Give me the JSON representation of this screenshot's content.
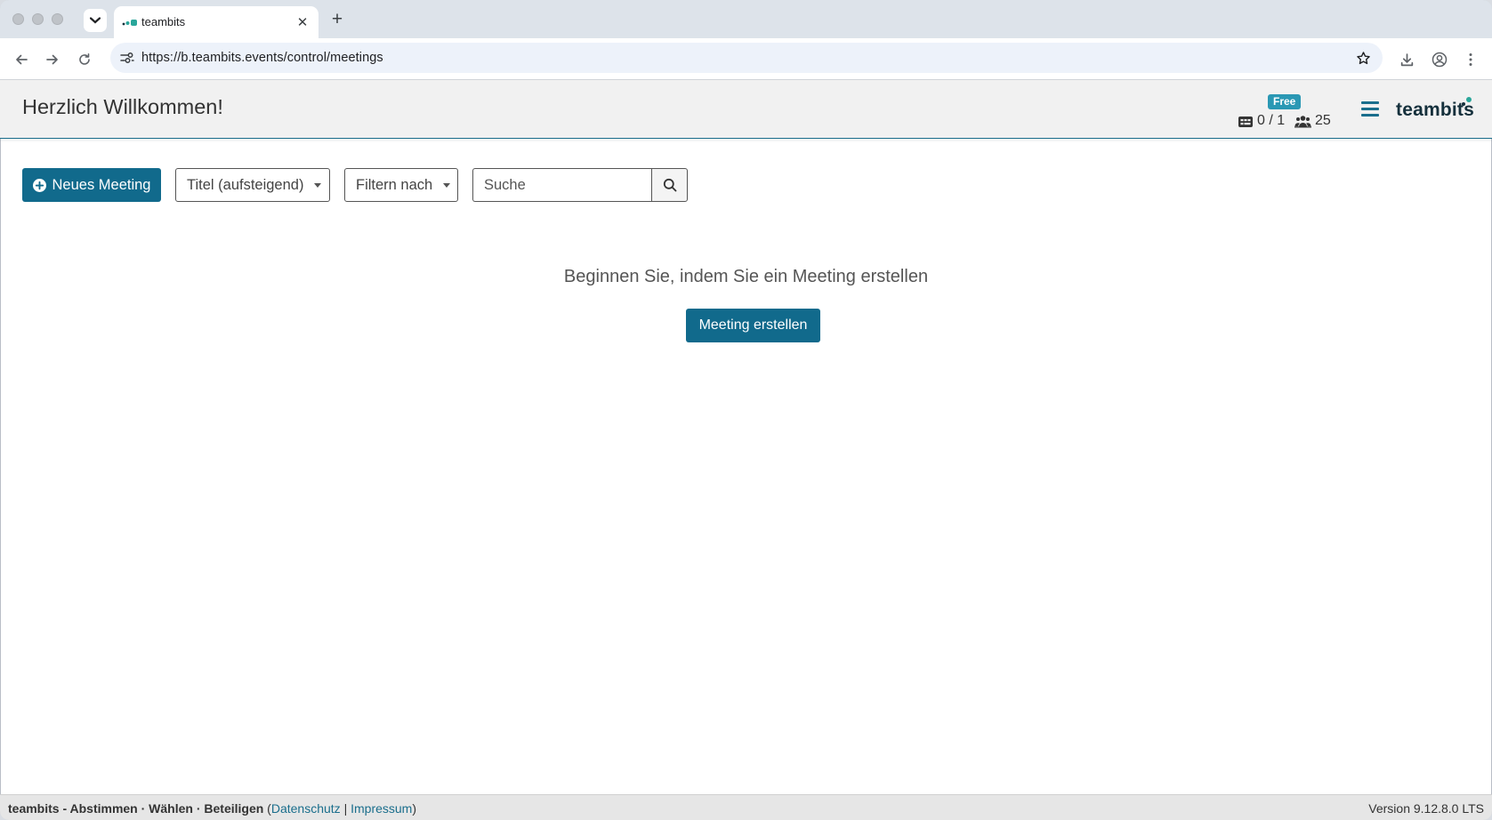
{
  "browser": {
    "tab_title": "teambits",
    "tab_close": "✕",
    "new_tab": "+",
    "url": "https://b.teambits.events/control/meetings"
  },
  "header": {
    "title": "Herzlich Willkommen!",
    "plan_badge": "Free",
    "meetings_count": "0 / 1",
    "participants_count": "25",
    "logo_text": "teambits",
    "brand_color": "#116a8c",
    "accent_color": "#2aa69a"
  },
  "toolbar": {
    "new_meeting_label": "Neues Meeting",
    "sort_label": "Titel (aufsteigend)",
    "filter_label": "Filtern nach",
    "search_placeholder": "Suche"
  },
  "empty_state": {
    "message": "Beginnen Sie, indem Sie ein Meeting erstellen",
    "create_label": "Meeting erstellen"
  },
  "footer": {
    "brand": "teambits - Abstimmen · Wählen · Beteiligen",
    "open_paren": " (",
    "privacy_link": "Datenschutz",
    "separator": " | ",
    "imprint_link": "Impressum",
    "close_paren": ")",
    "version": "Version 9.12.8.0 LTS"
  }
}
